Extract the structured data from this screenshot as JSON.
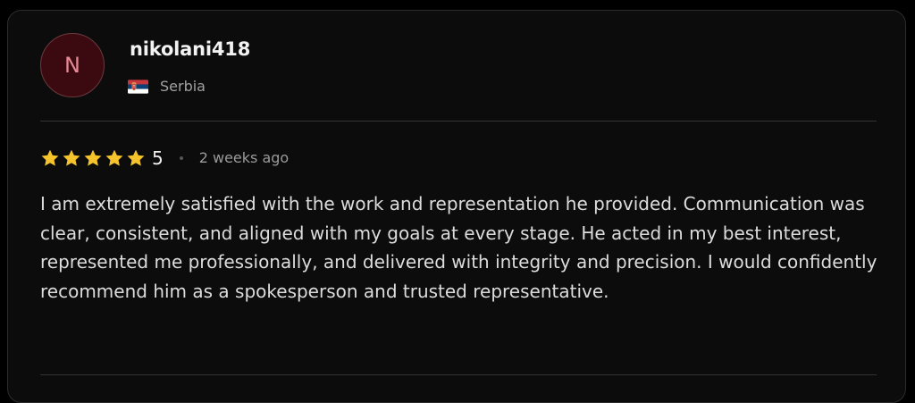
{
  "review": {
    "avatar_initial": "N",
    "username": "nikolani418",
    "country": "Serbia",
    "flag_icon": "serbia-flag-icon",
    "rating": "5",
    "stars_filled": 5,
    "stars_total": 5,
    "time_ago": "2 weeks ago",
    "text": "I am extremely satisfied with the work and representation he provided. Communication was clear, consistent, and aligned with my goals at every stage. He acted in my best interest, represented me professionally, and delivered with integrity and precision. I would confidently recommend him as a spokesperson and trusted representative."
  },
  "colors": {
    "background": "#000000",
    "card": "#0c0c0c",
    "star": "#f5c32b",
    "avatar_bg": "#3a0a10",
    "avatar_text": "#e58a95"
  }
}
